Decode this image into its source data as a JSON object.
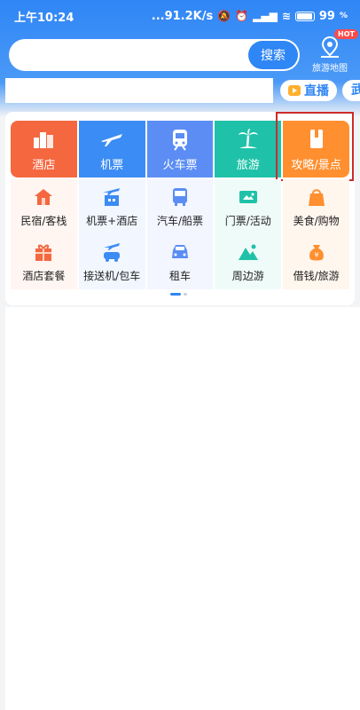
{
  "status_bar": {
    "time": "上午10:24",
    "network_speed": "...91.2K/s",
    "battery": "99"
  },
  "search": {
    "placeholder": "",
    "button_label": "搜索"
  },
  "map_entry": {
    "label": "旅游地图",
    "badge": "HOT"
  },
  "tabs": {
    "live_label": "直播",
    "city_label": "武"
  },
  "main_categories": [
    {
      "label": "酒店",
      "icon": "hotel-icon",
      "color": "#f5673f"
    },
    {
      "label": "机票",
      "icon": "plane-icon",
      "color": "#3b8cf4"
    },
    {
      "label": "火车票",
      "icon": "train-icon",
      "color": "#5b8df4"
    },
    {
      "label": "旅游",
      "icon": "palm-tree-icon",
      "color": "#1fc2a8"
    },
    {
      "label": "攻略/景点",
      "icon": "guidebook-icon",
      "color": "#ff8f2f"
    }
  ],
  "sub_categories": [
    {
      "label": "民宿/客栈",
      "icon": "homestay-icon"
    },
    {
      "label": "机票+酒店",
      "icon": "flight-hotel-icon"
    },
    {
      "label": "汽车/船票",
      "icon": "bus-icon"
    },
    {
      "label": "门票/活动",
      "icon": "ticket-icon"
    },
    {
      "label": "美食/购物",
      "icon": "shopping-bag-icon"
    },
    {
      "label": "酒店套餐",
      "icon": "hotel-package-icon"
    },
    {
      "label": "接送机/包车",
      "icon": "airport-transfer-icon"
    },
    {
      "label": "租车",
      "icon": "car-icon"
    },
    {
      "label": "周边游",
      "icon": "mountain-icon"
    },
    {
      "label": "借钱/旅游",
      "icon": "money-bag-icon"
    }
  ]
}
